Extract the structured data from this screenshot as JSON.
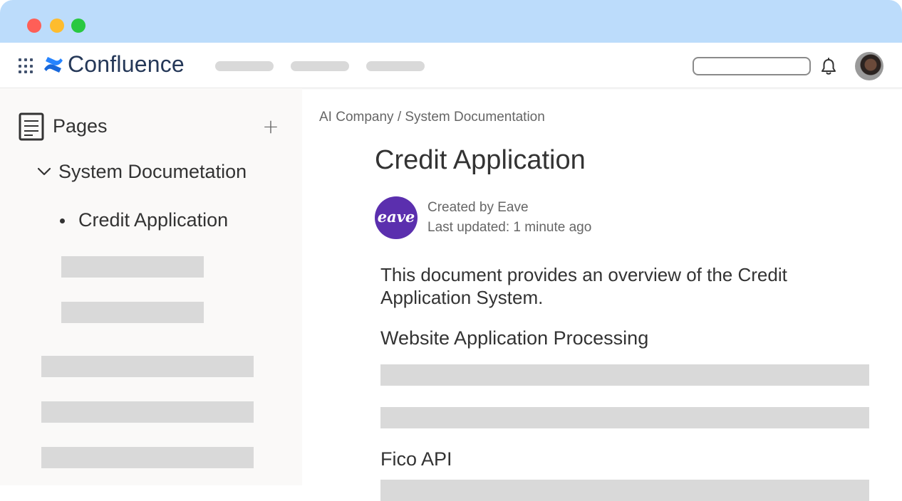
{
  "window": {
    "traffic_lights": [
      "#fe5f57",
      "#febc2e",
      "#28c840"
    ],
    "titlebar_color": "#bcdcfb"
  },
  "topnav": {
    "apps_icon": "grid-dots-icon",
    "logo_icon": "confluence-logo-icon",
    "logo_text": "Confluence",
    "brand_color": "#2684ff",
    "notifications_icon": "bell-icon"
  },
  "sidebar": {
    "title": "Pages",
    "add_label": "+",
    "tree": {
      "parent_label": "System Documetation",
      "child_label": "Credit Application"
    }
  },
  "main": {
    "breadcrumb": "AI Company / System Documentation",
    "page_title": "Credit Application",
    "author_avatar_text": "eave",
    "author_avatar_color": "#5b2fae",
    "created_by": "Created by Eave",
    "last_updated": "Last updated: 1 minute ago",
    "intro": "This document provides an overview of the Credit Application System.",
    "sections": [
      {
        "heading": "Website Application Processing"
      },
      {
        "heading": "Fico API"
      }
    ]
  }
}
